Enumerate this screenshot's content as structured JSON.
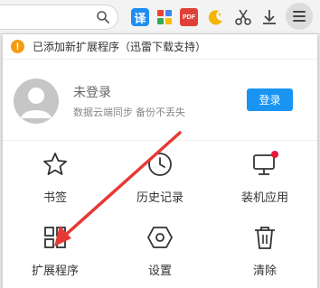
{
  "toolbar": {
    "translate_icon_text": "译",
    "pdf_icon_text": "PDF",
    "icons": [
      "search-icon",
      "translate-icon",
      "apps-icon",
      "pdf-icon",
      "night-mode-icon",
      "screenshot-scissors-icon",
      "download-icon",
      "menu-icon"
    ]
  },
  "notice": {
    "text": "已添加新扩展程序（迅雷下载支持）"
  },
  "account": {
    "status": "未登录",
    "description": "数据云端同步 备份不丢失",
    "login_label": "登录"
  },
  "grid": [
    {
      "label": "书签",
      "icon": "star-icon"
    },
    {
      "label": "历史记录",
      "icon": "clock-icon"
    },
    {
      "label": "装机应用",
      "icon": "monitor-icon",
      "badge": true
    },
    {
      "label": "扩展程序",
      "icon": "extensions-grid-icon"
    },
    {
      "label": "设置",
      "icon": "settings-hexagon-icon"
    },
    {
      "label": "清除",
      "icon": "trash-icon"
    }
  ],
  "colors": {
    "accent": "#1a94f2",
    "warning": "#f39c12",
    "annotation_arrow": "#e53935",
    "badge": "#e8193a"
  }
}
